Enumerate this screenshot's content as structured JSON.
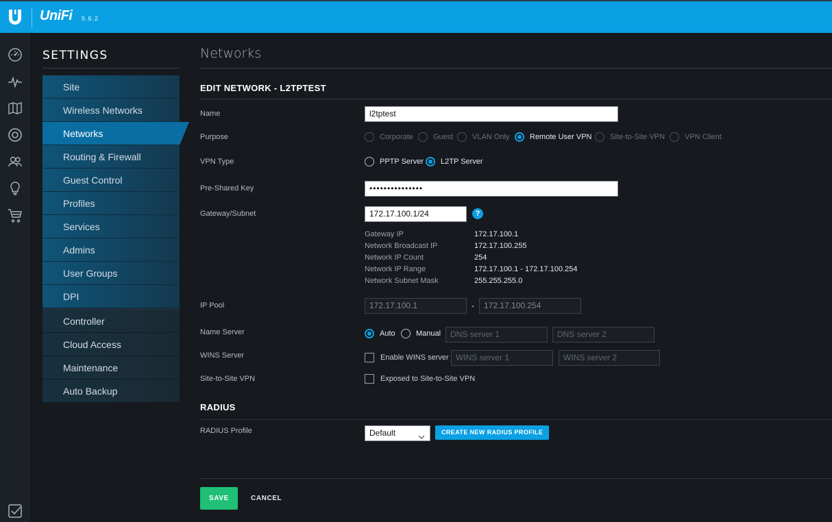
{
  "app": {
    "brand": "UniFi",
    "version": "5.6.2"
  },
  "colors": {
    "accent": "#0aa0e3",
    "save": "#1fbf75",
    "active_menu": "#0a6ea3"
  },
  "leftnav": {
    "icons": [
      "dashboard-icon",
      "statistics-icon",
      "map-icon",
      "devices-icon",
      "clients-icon",
      "insights-icon",
      "store-icon",
      "tasks-icon"
    ]
  },
  "settings": {
    "title": "SETTINGS",
    "menu": [
      {
        "label": "Site",
        "active": false
      },
      {
        "label": "Wireless Networks",
        "active": false
      },
      {
        "label": "Networks",
        "active": true
      },
      {
        "label": "Routing & Firewall",
        "active": false
      },
      {
        "label": "Guest Control",
        "active": false
      },
      {
        "label": "Profiles",
        "active": false
      },
      {
        "label": "Services",
        "active": false
      },
      {
        "label": "Admins",
        "active": false
      },
      {
        "label": "User Groups",
        "active": false
      },
      {
        "label": "DPI",
        "active": false
      }
    ],
    "menu2": [
      {
        "label": "Controller"
      },
      {
        "label": "Cloud Access"
      },
      {
        "label": "Maintenance"
      },
      {
        "label": "Auto Backup"
      }
    ]
  },
  "page": {
    "title": "Networks",
    "section": "EDIT NETWORK - L2TPTEST"
  },
  "form": {
    "name": {
      "label": "Name",
      "value": "l2tptest"
    },
    "purpose": {
      "label": "Purpose",
      "options": [
        "Corporate",
        "Guest",
        "VLAN Only",
        "Remote User VPN",
        "Site-to-Site VPN",
        "VPN Client"
      ],
      "selected": "Remote User VPN"
    },
    "vpn_type": {
      "label": "VPN Type",
      "options": [
        "PPTP Server",
        "L2TP Server"
      ],
      "selected": "L2TP Server"
    },
    "psk": {
      "label": "Pre-Shared Key",
      "value": "•••••••••••••••"
    },
    "gateway": {
      "label": "Gateway/Subnet",
      "value": "172.17.100.1/24",
      "help": "?"
    },
    "info": [
      {
        "key": "Gateway IP",
        "value": "172.17.100.1"
      },
      {
        "key": "Network Broadcast IP",
        "value": "172.17.100.255"
      },
      {
        "key": "Network IP Count",
        "value": "254"
      },
      {
        "key": "Network IP Range",
        "value": "172.17.100.1 - 172.17.100.254"
      },
      {
        "key": "Network Subnet Mask",
        "value": "255.255.255.0"
      }
    ],
    "ip_pool": {
      "label": "IP Pool",
      "start": "172.17.100.1",
      "separator": "-",
      "end": "172.17.100.254"
    },
    "name_server": {
      "label": "Name Server",
      "auto": "Auto",
      "manual": "Manual",
      "dns1_placeholder": "DNS server 1",
      "dns2_placeholder": "DNS server 2"
    },
    "wins": {
      "label": "WINS Server",
      "checkbox": "Enable WINS server",
      "wins1_placeholder": "WINS server 1",
      "wins2_placeholder": "WINS server 2"
    },
    "s2s": {
      "label": "Site-to-Site VPN",
      "checkbox": "Exposed to Site-to-Site VPN"
    }
  },
  "radius": {
    "section": "RADIUS",
    "label": "RADIUS Profile",
    "selected": "Default",
    "create_button": "CREATE NEW RADIUS PROFILE"
  },
  "footer": {
    "save": "SAVE",
    "cancel": "CANCEL"
  }
}
